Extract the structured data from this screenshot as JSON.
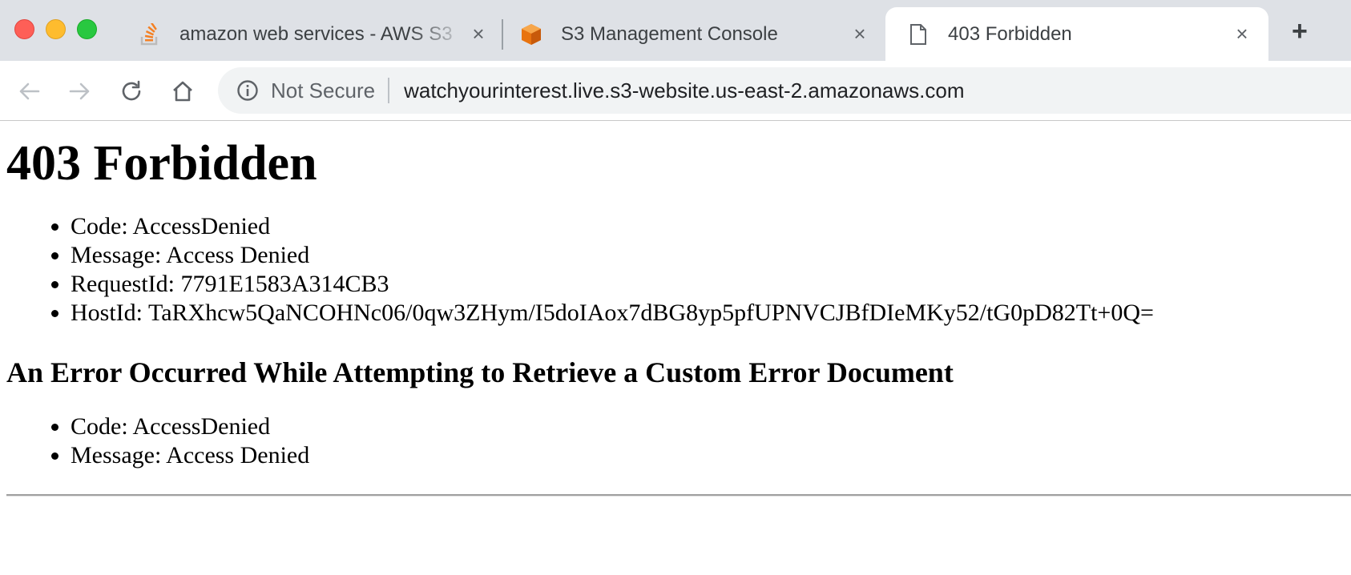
{
  "browser": {
    "tabs": [
      {
        "title": "amazon web services - AWS S3",
        "favicon": "stackoverflow-icon",
        "active": false
      },
      {
        "title": "S3 Management Console",
        "favicon": "aws-s3-icon",
        "active": false
      },
      {
        "title": "403 Forbidden",
        "favicon": "document-icon",
        "active": true
      }
    ],
    "new_tab_label": "+",
    "close_label": "×",
    "security_label": "Not Secure",
    "url": "watchyourinterest.live.s3-website.us-east-2.amazonaws.com",
    "colors": {
      "tabbar": "#dee1e6",
      "omnibox": "#f1f3f4",
      "close_red": "#fe5f57",
      "minimize_yellow": "#febc2e",
      "zoom_green": "#28c840"
    }
  },
  "page": {
    "heading": "403 Forbidden",
    "details": [
      "Code: AccessDenied",
      "Message: Access Denied",
      "RequestId: 7791E1583A314CB3",
      "HostId: TaRXhcw5QaNCOHNc06/0qw3ZHym/I5doIAox7dBG8yp5pfUPNVCJBfDIeMKy52/tG0pD82Tt+0Q="
    ],
    "subheading": "An Error Occurred While Attempting to Retrieve a Custom Error Document",
    "error_details": [
      "Code: AccessDenied",
      "Message: Access Denied"
    ]
  }
}
